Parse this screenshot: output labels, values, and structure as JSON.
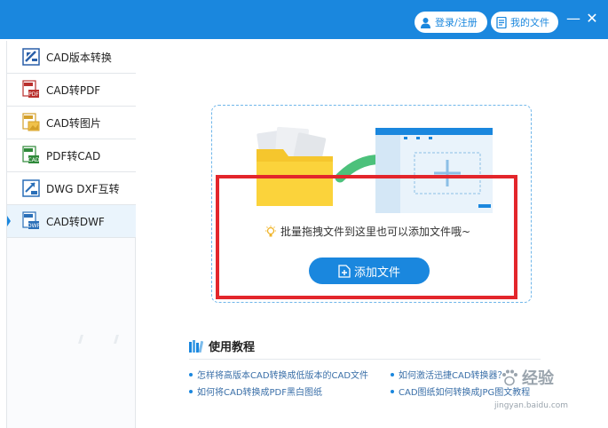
{
  "header": {
    "login_label": "登录/注册",
    "files_label": "我的文件",
    "min_glyph": "—",
    "close_glyph": "✕",
    "accent": "#1a87de"
  },
  "sidebar": {
    "items": [
      {
        "label": "CAD版本转换",
        "icon": "cad-version-convert-icon"
      },
      {
        "label": "CAD转PDF",
        "icon": "cad-to-pdf-icon"
      },
      {
        "label": "CAD转图片",
        "icon": "cad-to-image-icon"
      },
      {
        "label": "PDF转CAD",
        "icon": "pdf-to-cad-icon"
      },
      {
        "label": "DWG DXF互转",
        "icon": "dwg-dxf-convert-icon"
      },
      {
        "label": "CAD转DWF",
        "icon": "cad-to-dwf-icon",
        "active": true
      }
    ]
  },
  "main": {
    "hint": "批量拖拽文件到这里也可以添加文件哦~",
    "add_file_label": "添加文件",
    "highlight_color": "#e3262b"
  },
  "tutorials": {
    "title": "使用教程",
    "links": [
      "怎样将高版本CAD转换成低版本的CAD文件",
      "如何激活迅捷CAD转换器？",
      "如何将CAD转换成PDF黑白图纸",
      "CAD图纸如何转换成JPG图文教程"
    ]
  },
  "watermark": {
    "logo_text": "经验",
    "url": "jingyan.baidu.com"
  }
}
